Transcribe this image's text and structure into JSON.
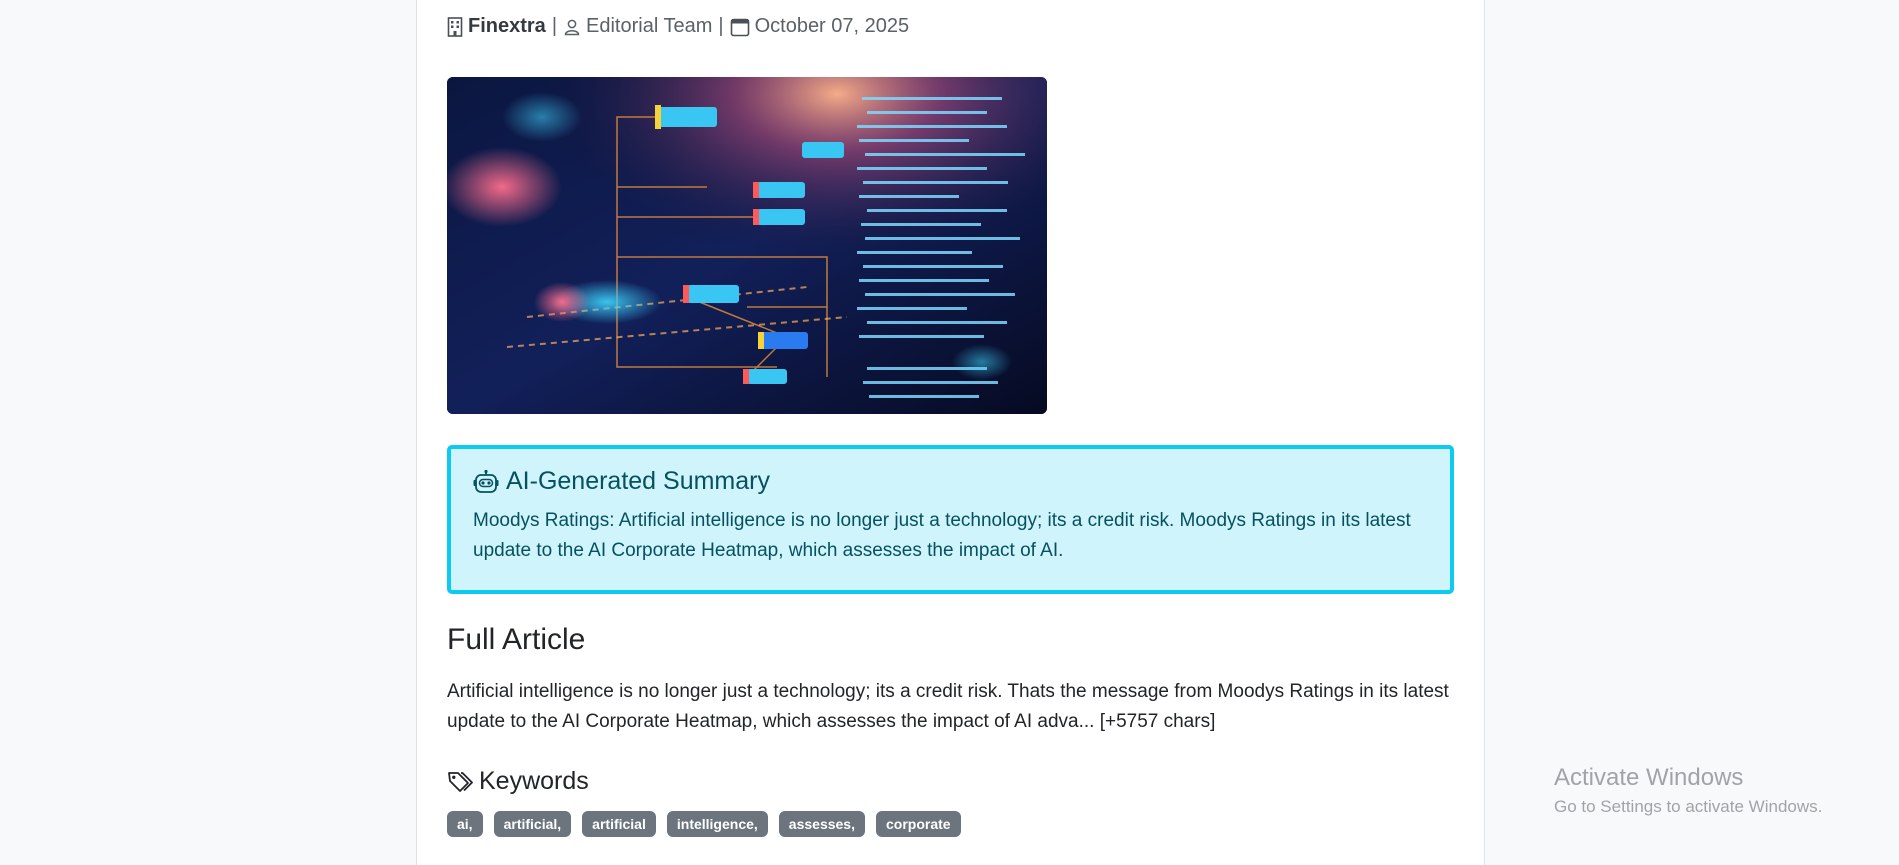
{
  "meta": {
    "source": "Finextra",
    "author": "Editorial Team",
    "date": "October 07, 2025",
    "separator": "|"
  },
  "hero": {
    "icon": "code-diagram-image"
  },
  "summary": {
    "title": "AI-Generated Summary",
    "icon": "robot-icon",
    "text": "Moodys Ratings: Artificial intelligence is no longer just a technology; its a credit risk. Moodys Ratings in its latest update to the AI Corporate Heatmap, which assesses the impact of AI."
  },
  "article": {
    "heading": "Full Article",
    "body": "Artificial intelligence is no longer just a technology; its a credit risk. Thats the message from Moodys Ratings in its latest update to the AI Corporate Heatmap, which assesses the impact of AI adva... [+5757 chars]"
  },
  "keywords": {
    "heading": "Keywords",
    "items": [
      "ai,",
      "artificial,",
      "artificial",
      "intelligence,",
      "assesses,",
      "corporate"
    ]
  },
  "watermark": {
    "title": "Activate Windows",
    "subtitle": "Go to Settings to activate Windows."
  },
  "colors": {
    "summary_bg": "#cff4fc",
    "summary_border": "#0dcaf0",
    "summary_text": "#055160",
    "badge_bg": "#6c757d"
  }
}
